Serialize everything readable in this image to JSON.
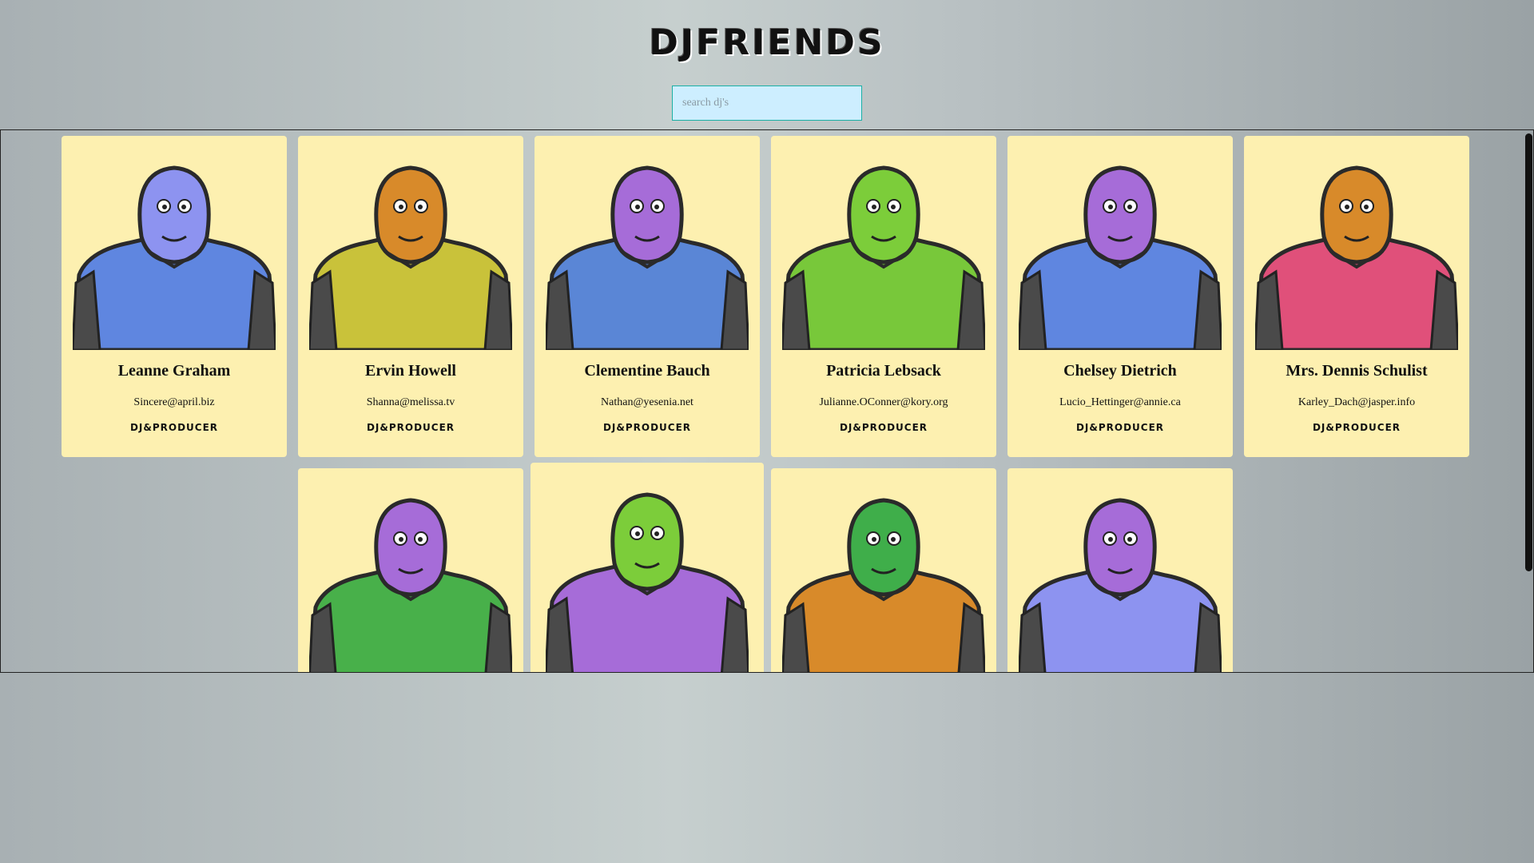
{
  "app": {
    "logo": "DJFRIENDS",
    "search_placeholder": "search dj's"
  },
  "colors": {
    "card_background": "#fdf0b0",
    "search_background": "#cdeeff",
    "search_border": "#1bb0a5"
  },
  "djs": [
    {
      "name": "Leanne Graham",
      "email": "Sincere@april.biz",
      "role": "DJ&PRODUCER",
      "skin": "#8d93f0",
      "suit": "#5f86e0",
      "icon": "blue-horned-monster-icon"
    },
    {
      "name": "Ervin Howell",
      "email": "Shanna@melissa.tv",
      "role": "DJ&PRODUCER",
      "skin": "#d88a2a",
      "suit": "#c9c23a",
      "icon": "orange-spiky-monster-icon"
    },
    {
      "name": "Clementine Bauch",
      "email": "Nathan@yesenia.net",
      "role": "DJ&PRODUCER",
      "skin": "#a66cd8",
      "suit": "#5a86d6",
      "icon": "purple-cyclops-robot-icon"
    },
    {
      "name": "Patricia Lebsack",
      "email": "Julianne.OConner@kory.org",
      "role": "DJ&PRODUCER",
      "skin": "#7ccd3a",
      "suit": "#78c83a",
      "icon": "green-helmet-monster-icon"
    },
    {
      "name": "Chelsey Dietrich",
      "email": "Lucio_Hettinger@annie.ca",
      "role": "DJ&PRODUCER",
      "skin": "#a66cd8",
      "suit": "#5f86e0",
      "icon": "purple-robot-monster-icon"
    },
    {
      "name": "Mrs. Dennis Schulist",
      "email": "Karley_Dach@jasper.info",
      "role": "DJ&PRODUCER",
      "skin": "#d88a2a",
      "suit": "#e0507a",
      "icon": "orange-antenna-monster-icon"
    },
    {
      "name": "",
      "email": "",
      "role": "",
      "skin": "#a66cd8",
      "suit": "#48b04a",
      "icon": "purple-horned-monster-icon"
    },
    {
      "name": "",
      "email": "",
      "role": "",
      "skin": "#7ccd3a",
      "suit": "#a66cd8",
      "icon": "green-cyclops-robot-icon"
    },
    {
      "name": "",
      "email": "",
      "role": "",
      "skin": "#3fae4a",
      "suit": "#d88a2a",
      "icon": "green-horned-monster-icon"
    },
    {
      "name": "",
      "email": "",
      "role": "",
      "skin": "#a66cd8",
      "suit": "#8d93f0",
      "icon": "purple-smiley-monster-icon"
    }
  ]
}
